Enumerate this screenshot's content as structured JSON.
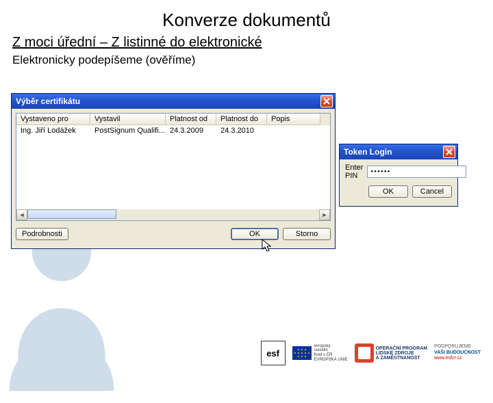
{
  "slide": {
    "title": "Konverze dokumentů",
    "subtitle": "Z moci úřední – Z listinné do elektronické",
    "line": "Elektronicky podepíšeme (ověříme)"
  },
  "cert_window": {
    "title": "Výběr certifikátu",
    "columns": [
      "Vystaveno pro",
      "Vystavil",
      "Platnost od",
      "Platnost do",
      "Popis"
    ],
    "row": {
      "issued_to": "Ing. Jiří Lodážek",
      "issuer": "PostSignum Qualifi...",
      "valid_from": "24.3.2009",
      "valid_to": "24.3.2010",
      "desc": ""
    },
    "details_btn": "Podrobnosti",
    "ok_btn": "OK",
    "cancel_btn": "Storno"
  },
  "token_window": {
    "title": "Token Login",
    "pin_label": "Enter PIN",
    "pin_value": "••••••",
    "ok_btn": "OK",
    "cancel_btn": "Cancel"
  },
  "footer": {
    "esf": "esf",
    "eu1": "evropský",
    "eu2": "sociální",
    "eu3": "fond v ČR",
    "eu4": "EVROPSKÁ UNIE",
    "op1": "OPERAČNÍ PROGRAM",
    "op2": "LIDSKÉ ZDROJE",
    "op3": "A ZAMĚSTNANOST",
    "s1": "PODPORUJEME",
    "s2": "VAŠI BUDOUCNOST",
    "s3": "www.esfcr.cz"
  }
}
